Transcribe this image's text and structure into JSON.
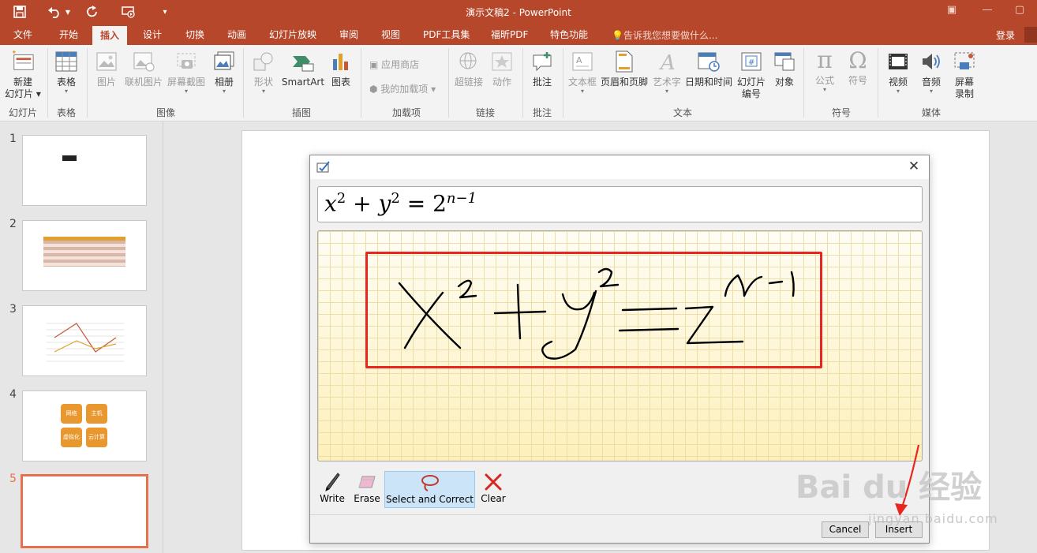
{
  "window": {
    "title": "演示文稿2 - PowerPoint"
  },
  "tabs": {
    "items": [
      "文件",
      "开始",
      "插入",
      "设计",
      "切换",
      "动画",
      "幻灯片放映",
      "审阅",
      "视图",
      "PDF工具集",
      "福昕PDF",
      "特色功能"
    ],
    "active": "插入",
    "tell_me": "告诉我您想要做什么...",
    "login": "登录"
  },
  "ribbon": {
    "new_slide_1": "新建",
    "new_slide_2": "幻灯片",
    "table": "表格",
    "picture": "图片",
    "online_picture": "联机图片",
    "screenshot": "屏幕截图",
    "album": "相册",
    "shapes": "形状",
    "smartart": "SmartArt",
    "chart": "图表",
    "app_store": "应用商店",
    "my_addins": "我的加载项",
    "hyperlink": "超链接",
    "action": "动作",
    "comment": "批注",
    "textbox": "文本框",
    "header_footer": "页眉和页脚",
    "wordart": "艺术字",
    "date_time": "日期和时间",
    "slide_number_1": "幻灯片",
    "slide_number_2": "编号",
    "object": "对象",
    "equation": "公式",
    "symbol": "符号",
    "video": "视频",
    "audio": "音频",
    "screen_record_1": "屏幕",
    "screen_record_2": "录制",
    "groups": {
      "slides": "幻灯片",
      "tables": "表格",
      "images": "图像",
      "illustrations": "插图",
      "addins": "加载项",
      "links": "链接",
      "comments": "批注",
      "text": "文本",
      "symbols": "符号",
      "media": "媒体"
    }
  },
  "thumbnails": {
    "numbers": [
      "1",
      "2",
      "3",
      "4",
      "5"
    ],
    "selected": "5",
    "slide4_boxes": [
      "网络",
      "主机",
      "虚拟化",
      "云计算"
    ]
  },
  "dialog": {
    "preview": {
      "x": "x",
      "y": "y",
      "two": "2",
      "exp_x": "2",
      "exp_y": "2",
      "plus": "+",
      "equals": "=",
      "exp_n": "n−1"
    },
    "tools": {
      "write": "Write",
      "erase": "Erase",
      "select_correct": "Select and Correct",
      "clear": "Clear"
    },
    "active_tool": "Select and Correct",
    "buttons": {
      "cancel": "Cancel",
      "insert": "Insert"
    }
  },
  "watermark": {
    "main": "Bai  du 经验",
    "url": "jingyan.baidu.com"
  },
  "colors": {
    "accent": "#b7472a",
    "highlight": "#e8251e",
    "selected_thumb": "#e8704f"
  }
}
